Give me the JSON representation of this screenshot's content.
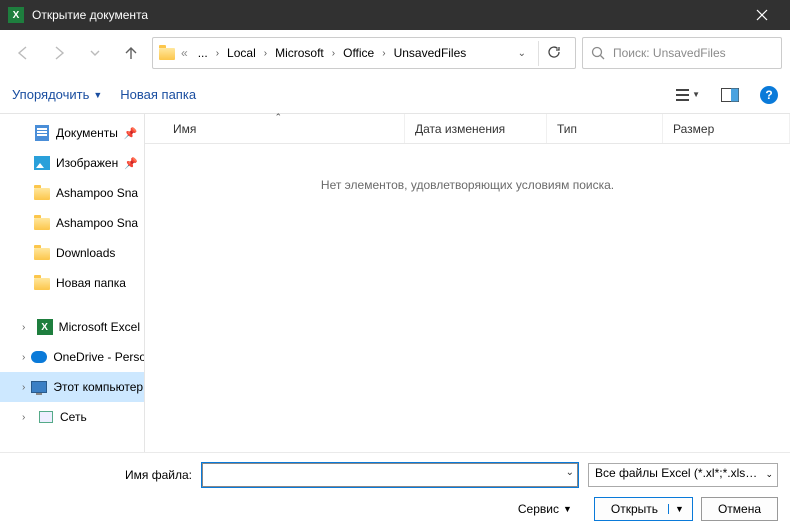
{
  "titlebar": {
    "title": "Открытие документа"
  },
  "breadcrumbs": {
    "ellipsis": "...",
    "items": [
      "Local",
      "Microsoft",
      "Office",
      "UnsavedFiles"
    ]
  },
  "search": {
    "placeholder": "Поиск: UnsavedFiles"
  },
  "toolbar": {
    "organize": "Упорядочить",
    "new_folder": "Новая папка"
  },
  "sidebar": {
    "items": [
      {
        "label": "Документы",
        "icon": "doc",
        "pinned": true,
        "indent": "indent"
      },
      {
        "label": "Изображен",
        "icon": "img",
        "pinned": true,
        "indent": "indent"
      },
      {
        "label": "Ashampoo Sna",
        "icon": "folder",
        "indent": "indent"
      },
      {
        "label": "Ashampoo Sna",
        "icon": "folder",
        "indent": "indent"
      },
      {
        "label": "Downloads",
        "icon": "folder",
        "indent": "indent"
      },
      {
        "label": "Новая папка",
        "icon": "folder",
        "indent": "indent"
      },
      {
        "label": "Microsoft Excel",
        "icon": "excel",
        "expand": true,
        "indent": "indent2"
      },
      {
        "label": "OneDrive - Perso",
        "icon": "onedrive",
        "expand": true,
        "indent": "indent2"
      },
      {
        "label": "Этот компьютер",
        "icon": "pc",
        "expand": true,
        "selected": true,
        "indent": "indent2"
      },
      {
        "label": "Сеть",
        "icon": "net",
        "expand": true,
        "indent": "indent2"
      }
    ]
  },
  "columns": {
    "name": "Имя",
    "date": "Дата изменения",
    "type": "Тип",
    "size": "Размер"
  },
  "content": {
    "empty_message": "Нет элементов, удовлетворяющих условиям поиска."
  },
  "bottom": {
    "filename_label": "Имя файла:",
    "filename_value": "",
    "filter_label": "Все файлы Excel (*.xl*;*.xlsx;*.x",
    "service": "Сервис",
    "open": "Открыть",
    "cancel": "Отмена"
  }
}
